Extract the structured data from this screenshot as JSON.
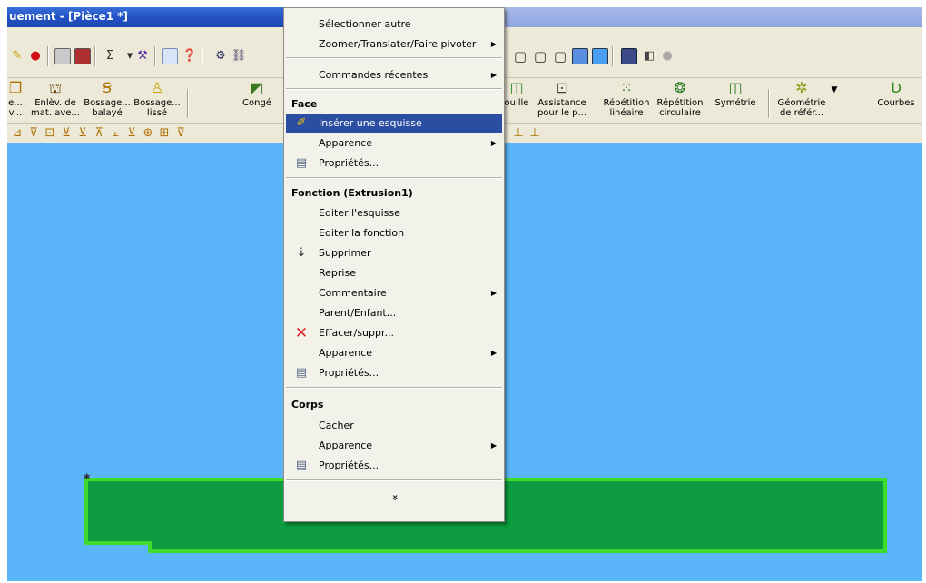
{
  "window": {
    "title": "uement - [Pièce1 *]"
  },
  "colors": {
    "viewport_bg": "#5ab5f9",
    "part_fill": "#0d9c3f",
    "part_edge": "#3edb2a",
    "menu_highlight": "#2b4ea2",
    "delete_red": "#e02020"
  },
  "features": [
    {
      "icon": "boss-icon",
      "label1": "e...",
      "label2": "v..."
    },
    {
      "icon": "cut-icon",
      "label1": "Enlèv. de",
      "label2": "mat. ave..."
    },
    {
      "icon": "sweep-icon",
      "label1": "Bossage...",
      "label2": "balayé"
    },
    {
      "icon": "loft-icon",
      "label1": "Bossage...",
      "label2": "lissé"
    },
    {
      "icon": "fillet-icon",
      "label1": "Congé",
      "label2": ""
    },
    {
      "icon": "shell-icon",
      "label1": "ouille",
      "label2": ""
    },
    {
      "icon": "hole-wizard-icon",
      "label1": "Assistance",
      "label2": "pour le p..."
    },
    {
      "icon": "linear-pattern-icon",
      "label1": "Répétition",
      "label2": "linéaire"
    },
    {
      "icon": "circular-pattern-icon",
      "label1": "Répétition",
      "label2": "circulaire"
    },
    {
      "icon": "mirror-icon",
      "label1": "Symétrie",
      "label2": ""
    },
    {
      "icon": "reference-geometry-icon",
      "label1": "Géométrie",
      "label2": "de référ..."
    },
    {
      "icon": "curves-icon",
      "label1": "Courbes",
      "label2": ""
    }
  ],
  "menu": {
    "items": [
      {
        "label": "Sélectionner autre"
      },
      {
        "label": "Zoomer/Translater/Faire pivoter",
        "submenu": true
      },
      {
        "label": "Commandes récentes",
        "submenu": true
      }
    ],
    "face_header": "Face",
    "face_items": [
      {
        "label": "Insérer une esquisse",
        "icon": "sketch-icon",
        "highlighted": true
      },
      {
        "label": "Apparence",
        "submenu": true
      },
      {
        "label": "Propriétés...",
        "icon": "properties-icon"
      }
    ],
    "feature_header": "Fonction (Extrusion1)",
    "feature_items": [
      {
        "label": "Editer l'esquisse"
      },
      {
        "label": "Editer la fonction"
      },
      {
        "label": "Supprimer",
        "icon": "suppress-icon"
      },
      {
        "label": "Reprise"
      },
      {
        "label": "Commentaire",
        "submenu": true
      },
      {
        "label": "Parent/Enfant..."
      },
      {
        "label": "Effacer/suppr...",
        "icon": "delete-icon"
      },
      {
        "label": "Apparence",
        "submenu": true
      },
      {
        "label": "Propriétés...",
        "icon": "properties-icon"
      }
    ],
    "body_header": "Corps",
    "body_items": [
      {
        "label": "Cacher"
      },
      {
        "label": "Apparence",
        "submenu": true
      },
      {
        "label": "Propriétés...",
        "icon": "properties-icon"
      }
    ],
    "expand_glyph": "»"
  }
}
